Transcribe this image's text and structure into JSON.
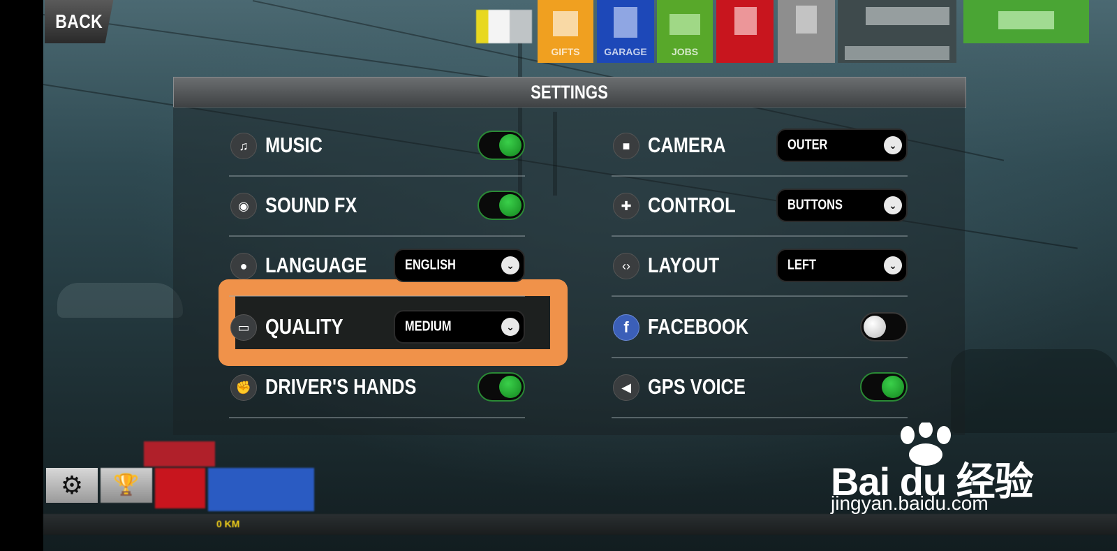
{
  "topbar": {
    "back_label": "BACK",
    "tiles": [
      {
        "label": "GIFTS",
        "color": "#f0a020"
      },
      {
        "label": "GARAGE",
        "color": "#1d48b8"
      },
      {
        "label": "JOBS",
        "color": "#58a82a"
      },
      {
        "label": "",
        "color": "#c8151e"
      },
      {
        "label": "",
        "color": "#8e8e8e"
      },
      {
        "label": "",
        "color": "#3e4a4c"
      },
      {
        "label": "",
        "color": "#4aa534"
      }
    ]
  },
  "settings": {
    "title": "SETTINGS",
    "left": [
      {
        "label": "MUSIC",
        "icon": "music-note-icon",
        "glyph": "♫",
        "control": "toggle",
        "value": true
      },
      {
        "label": "SOUND FX",
        "icon": "sound-fx-icon",
        "glyph": "◉",
        "control": "toggle",
        "value": true
      },
      {
        "label": "LANGUAGE",
        "icon": "speech-bubble-icon",
        "glyph": "●",
        "control": "select",
        "value": "ENGLISH"
      },
      {
        "label": "QUALITY",
        "icon": "monitor-icon",
        "glyph": "▭",
        "control": "select",
        "value": "MEDIUM"
      },
      {
        "label": "DRIVER'S HANDS",
        "icon": "hand-icon",
        "glyph": "✊",
        "control": "toggle",
        "value": true
      }
    ],
    "right": [
      {
        "label": "CAMERA",
        "icon": "video-camera-icon",
        "glyph": "■",
        "control": "select",
        "value": "OUTER"
      },
      {
        "label": "CONTROL",
        "icon": "gamepad-icon",
        "glyph": "✚",
        "control": "select",
        "value": "BUTTONS"
      },
      {
        "label": "LAYOUT",
        "icon": "code-brackets-icon",
        "glyph": "‹›",
        "control": "select",
        "value": "LEFT"
      },
      {
        "label": "FACEBOOK",
        "icon": "facebook-icon",
        "glyph": "f",
        "control": "toggle",
        "value": false
      },
      {
        "label": "GPS VOICE",
        "icon": "speaker-icon",
        "glyph": "◀",
        "control": "toggle",
        "value": true
      }
    ]
  },
  "highlight": {
    "color": "#f0924a",
    "target": "QUALITY"
  },
  "bottom": {
    "distance_text": "0 KM"
  },
  "watermark": {
    "brand": "Bai du 经验",
    "url": "jingyan.baidu.com"
  }
}
